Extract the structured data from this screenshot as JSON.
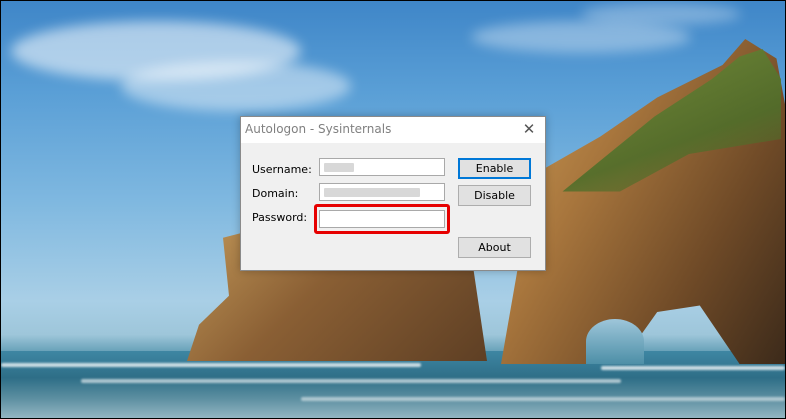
{
  "window": {
    "title": "Autologon - Sysinternals",
    "close_icon": "close-icon"
  },
  "form": {
    "username_label": "Username:",
    "domain_label": "Domain:",
    "password_label": "Password:",
    "username_value": "",
    "domain_value": "",
    "password_value": ""
  },
  "buttons": {
    "enable_label": "Enable",
    "disable_label": "Disable",
    "about_label": "About"
  },
  "colors": {
    "highlight": "#e60000",
    "default_button_border": "#0078d7",
    "dialog_bg": "#f0f0f0"
  }
}
